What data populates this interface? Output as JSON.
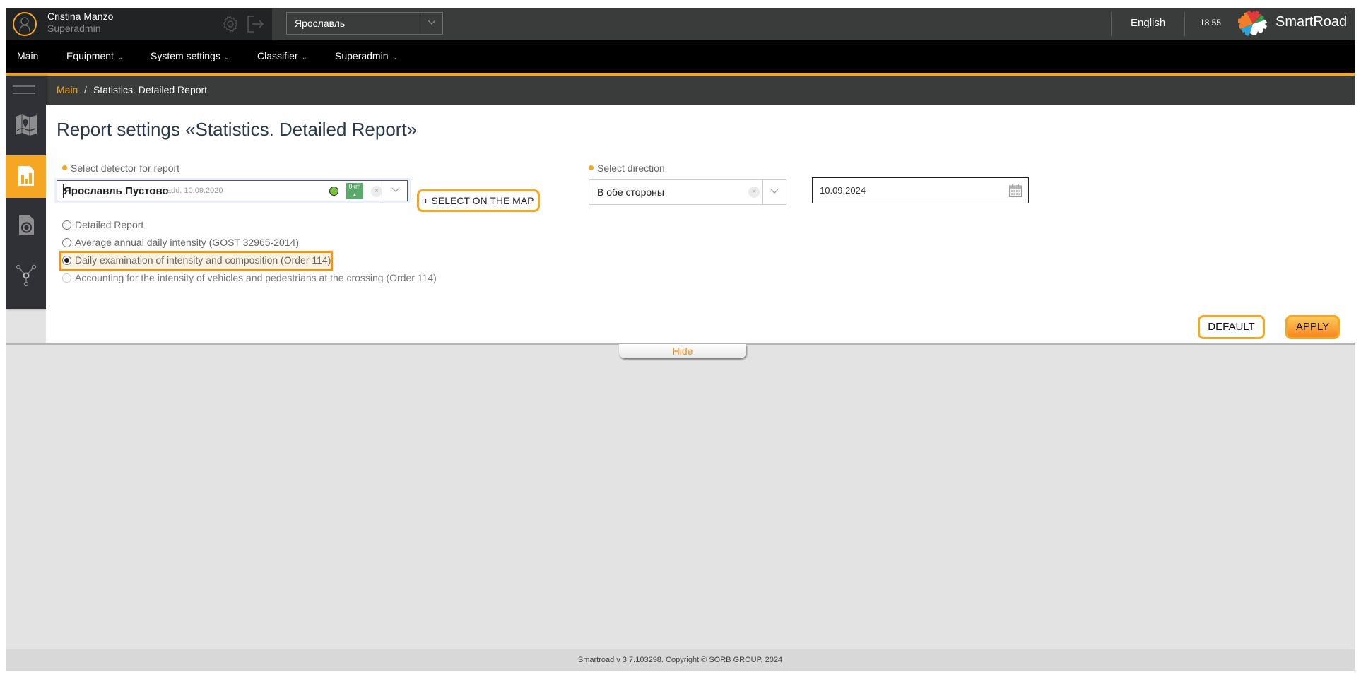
{
  "header": {
    "user_name": "Cristina Manzo",
    "user_role": "Superadmin",
    "city": "Ярославль",
    "language": "English",
    "clock": "18 55",
    "brand": "SmartRoad"
  },
  "nav": {
    "items": [
      {
        "label": "Main",
        "has_dropdown": false
      },
      {
        "label": "Equipment",
        "has_dropdown": true
      },
      {
        "label": "System settings",
        "has_dropdown": true
      },
      {
        "label": "Classifier",
        "has_dropdown": true
      },
      {
        "label": "Superadmin",
        "has_dropdown": true
      }
    ],
    "chevron": "⌄"
  },
  "breadcrumb": {
    "root": "Main",
    "separator": "/",
    "current": "Statistics. Detailed Report"
  },
  "sidebar": {
    "items": [
      {
        "icon": "map-icon",
        "active": false
      },
      {
        "icon": "report-chart-icon",
        "active": true
      },
      {
        "icon": "camera-device-icon",
        "active": false
      },
      {
        "icon": "network-nodes-icon",
        "active": false
      }
    ]
  },
  "main": {
    "title": "Report settings «Statistics. Detailed Report»",
    "detector": {
      "label": "Select detector for report",
      "value": "Ярославль Пустово",
      "added": "add. 10.09.2020",
      "status_color": "#7cc242",
      "km_badge": "0km",
      "clear_icon": "×"
    },
    "select_on_map_label": "+ SELECT ON THE MAP",
    "report_types": [
      {
        "label": "Detailed Report",
        "checked": false,
        "disabled": false
      },
      {
        "label": "Average annual daily intensity (GOST 32965-2014)",
        "checked": false,
        "disabled": false
      },
      {
        "label": "Daily examination of intensity and composition (Order 114)",
        "checked": true,
        "disabled": false
      },
      {
        "label": "Accounting for the intensity of vehicles and pedestrians at the crossing (Order 114)",
        "checked": false,
        "disabled": true
      }
    ],
    "direction": {
      "label": "Select direction",
      "value": "В обе стороны",
      "clear_icon": "×"
    },
    "date": {
      "value": "10.09.2024"
    },
    "default_label": "DEFAULT",
    "apply_label": "APPLY",
    "hide_label": "Hide"
  },
  "footer": {
    "text": "Smartroad v 3.7.103298. Copyright © SORB GROUP, 2024"
  },
  "colors": {
    "accent": "#f5a623",
    "header_bg": "#3a3b3b",
    "nav_bg": "#000000",
    "sidebar_bg": "#303136"
  }
}
